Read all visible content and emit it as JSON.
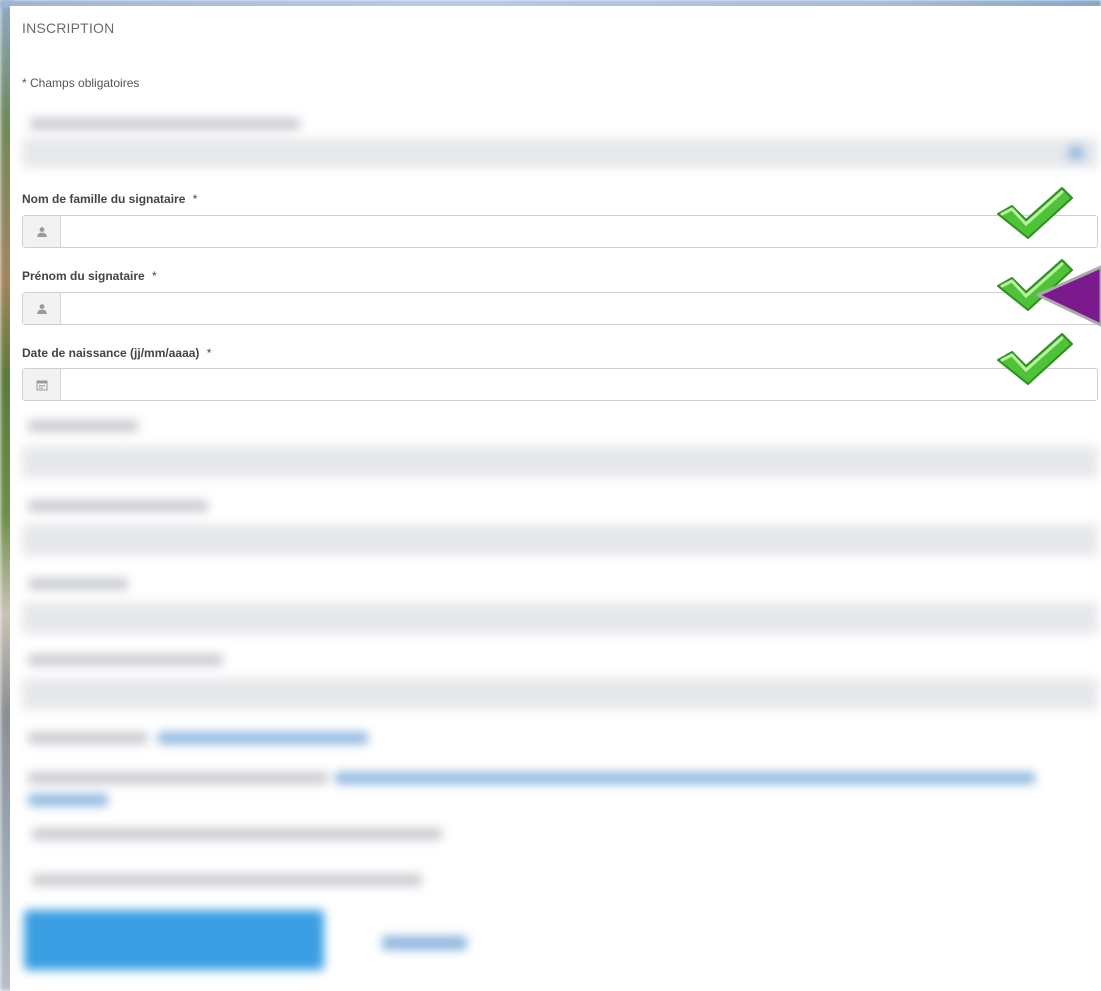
{
  "form": {
    "title": "INSCRIPTION",
    "required_note": "* Champs obligatoires",
    "fields": [
      {
        "label": "Nom de famille du signataire",
        "required_mark": "*",
        "value": "",
        "icon": "user-icon",
        "status": "valid"
      },
      {
        "label": "Prénom du signataire",
        "required_mark": "*",
        "value": "",
        "icon": "user-icon",
        "status": "valid"
      },
      {
        "label": "Date de naissance (jj/mm/aaaa)",
        "required_mark": "*",
        "value": "",
        "icon": "calendar-icon",
        "status": "valid"
      }
    ]
  },
  "colors": {
    "check_green": "#4fc23a",
    "arrow_purple": "#7a1a8c",
    "submit_blue": "#3a9ee3"
  }
}
